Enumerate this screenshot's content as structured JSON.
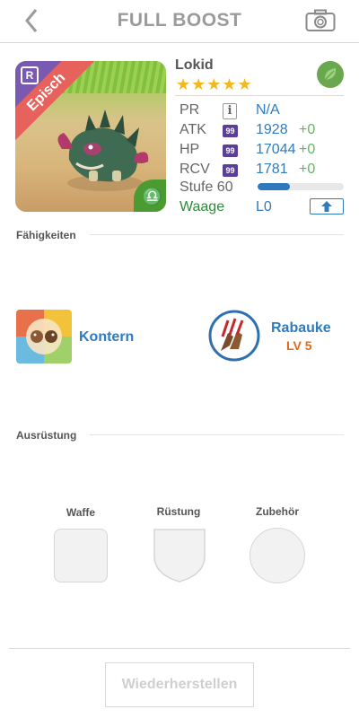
{
  "header": {
    "title": "FULL BOOST",
    "back_icon": "chevron-left-icon",
    "camera_icon": "camera-icon"
  },
  "monster": {
    "rarity_badge": "R",
    "rarity": "Episch",
    "name": "Lokid",
    "stars": "★★★★★",
    "star_count": 5,
    "element_icon": "leaf-icon",
    "stats": {
      "pr": {
        "label": "PR",
        "value": "N/A"
      },
      "atk": {
        "label": "ATK",
        "badge": "99",
        "value": "1928",
        "plus": "+0"
      },
      "hp": {
        "label": "HP",
        "badge": "99",
        "value": "17044",
        "plus": "+0"
      },
      "rcv": {
        "label": "RCV",
        "badge": "99",
        "value": "1781",
        "plus": "+0"
      }
    },
    "level_label": "Stufe 60",
    "level_progress": 0.37,
    "zodiac": "Waage",
    "limit": "L0"
  },
  "abilities": {
    "title": "Fähigkeiten",
    "skill_1": {
      "name": "Kontern",
      "icon": "counter-skill-icon"
    },
    "skill_2": {
      "name": "Rabauke",
      "level": "LV 5",
      "icon": "claw-skill-icon"
    }
  },
  "equipment": {
    "title": "Ausrüstung",
    "weapon": "Waffe",
    "armor": "Rüstung",
    "accessory": "Zubehör"
  },
  "footer": {
    "restore_label": "Wiederherstellen"
  },
  "colors": {
    "accent_blue": "#2f7bbf",
    "plus_green": "#5cb85c",
    "zodiac_green": "#2e8b3a",
    "skill_level_orange": "#e0681c",
    "star_gold": "#f2b81e",
    "rarity_red": "#e7615d"
  }
}
